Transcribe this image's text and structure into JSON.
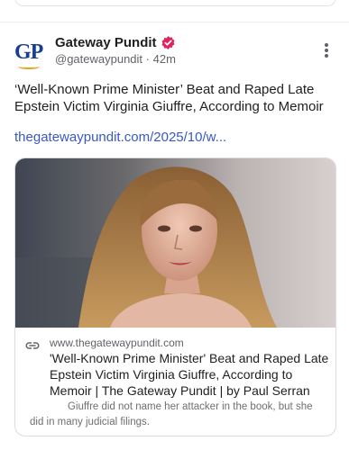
{
  "post": {
    "author": "Gateway Pundit",
    "handle": "@gatewaypundit",
    "separator": "·",
    "time": "42m",
    "avatar_text": "GP",
    "text": "‘Well-Known Prime Minister’ Beat and Raped Late Epstein Victim Virginia Giuffre, According to Memoir",
    "link": "thegatewaypundit.com/2025/10/w..."
  },
  "card": {
    "domain": "www.thegatewaypundit.com",
    "title": "'Well-Known Prime Minister' Beat and Raped Late Epstein Victim Virginia Giuffre, According to Memoir | The Gateway Pundit | by Paul Serran",
    "description": "Giuffre did not name her attacker in the book, but she did in many judicial filings."
  },
  "colors": {
    "verified": "#e0245e",
    "link": "#3a58c4",
    "brand": "#1a3f8e"
  },
  "icons": {
    "verified": "verified-badge-icon",
    "more": "more-vertical-icon",
    "link": "link-icon"
  }
}
